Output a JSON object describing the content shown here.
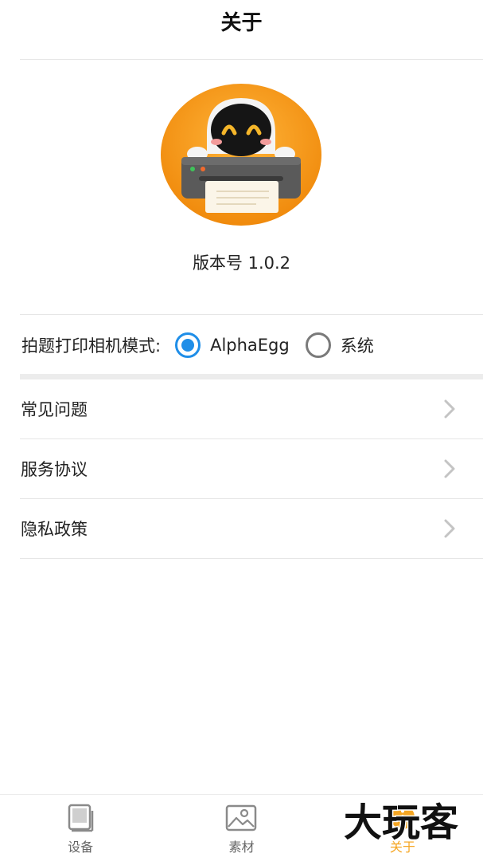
{
  "header": {
    "title": "关于"
  },
  "app": {
    "version": "版本号 1.0.2"
  },
  "camera_mode": {
    "label": "拍题打印相机模式:",
    "options": [
      {
        "label": "AlphaEgg",
        "selected": true
      },
      {
        "label": "系统",
        "selected": false
      }
    ],
    "accent_color": "#1f8ee8"
  },
  "menu": {
    "items": [
      {
        "label": "常见问题",
        "icon": "chevron-right-icon"
      },
      {
        "label": "服务协议",
        "icon": "chevron-right-icon"
      },
      {
        "label": "隐私政策",
        "icon": "chevron-right-icon"
      }
    ]
  },
  "tabbar": {
    "tabs": [
      {
        "label": "设备",
        "icon": "device-icon",
        "active": false
      },
      {
        "label": "素材",
        "icon": "image-icon",
        "active": false
      },
      {
        "label": "关于",
        "icon": "about-icon",
        "active": true
      }
    ],
    "active_color": "#f5a623"
  },
  "watermark": {
    "text": "大玩客"
  }
}
